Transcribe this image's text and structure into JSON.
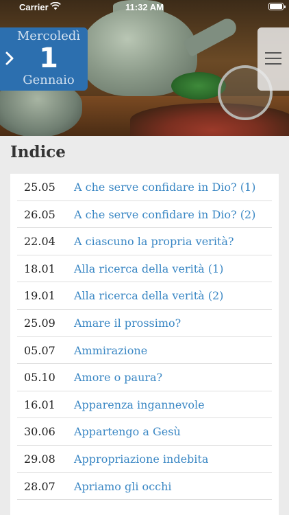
{
  "status_bar": {
    "carrier": "Carrier",
    "time": "11:32 AM",
    "wifi_icon": "wifi-icon",
    "battery_icon": "battery-icon"
  },
  "date_badge": {
    "weekday": "Mercoledì",
    "day": "1",
    "month": "Gennaio",
    "icon": "chevron-right-icon"
  },
  "menu": {
    "icon": "hamburger-menu-icon"
  },
  "page_title": "Indice",
  "entries": [
    {
      "date": "25.05",
      "title": "A che serve confidare in Dio? (1)"
    },
    {
      "date": "26.05",
      "title": "A che serve confidare in Dio? (2)"
    },
    {
      "date": "22.04",
      "title": "A ciascuno la propria verità?"
    },
    {
      "date": "18.01",
      "title": "Alla ricerca della verità (1)"
    },
    {
      "date": "19.01",
      "title": "Alla ricerca della verità (2)"
    },
    {
      "date": "25.09",
      "title": "Amare il prossimo?"
    },
    {
      "date": "05.07",
      "title": "Ammirazione"
    },
    {
      "date": "05.10",
      "title": "Amore o paura?"
    },
    {
      "date": "16.01",
      "title": "Apparenza ingannevole"
    },
    {
      "date": "30.06",
      "title": "Appartengo a Gesù"
    },
    {
      "date": "29.08",
      "title": "Appropriazione indebita"
    },
    {
      "date": "28.07",
      "title": "Apriamo gli occhi"
    }
  ],
  "colors": {
    "accent_blue": "#2c6faf",
    "link_blue": "#3a87c4",
    "background": "#ebebeb"
  }
}
